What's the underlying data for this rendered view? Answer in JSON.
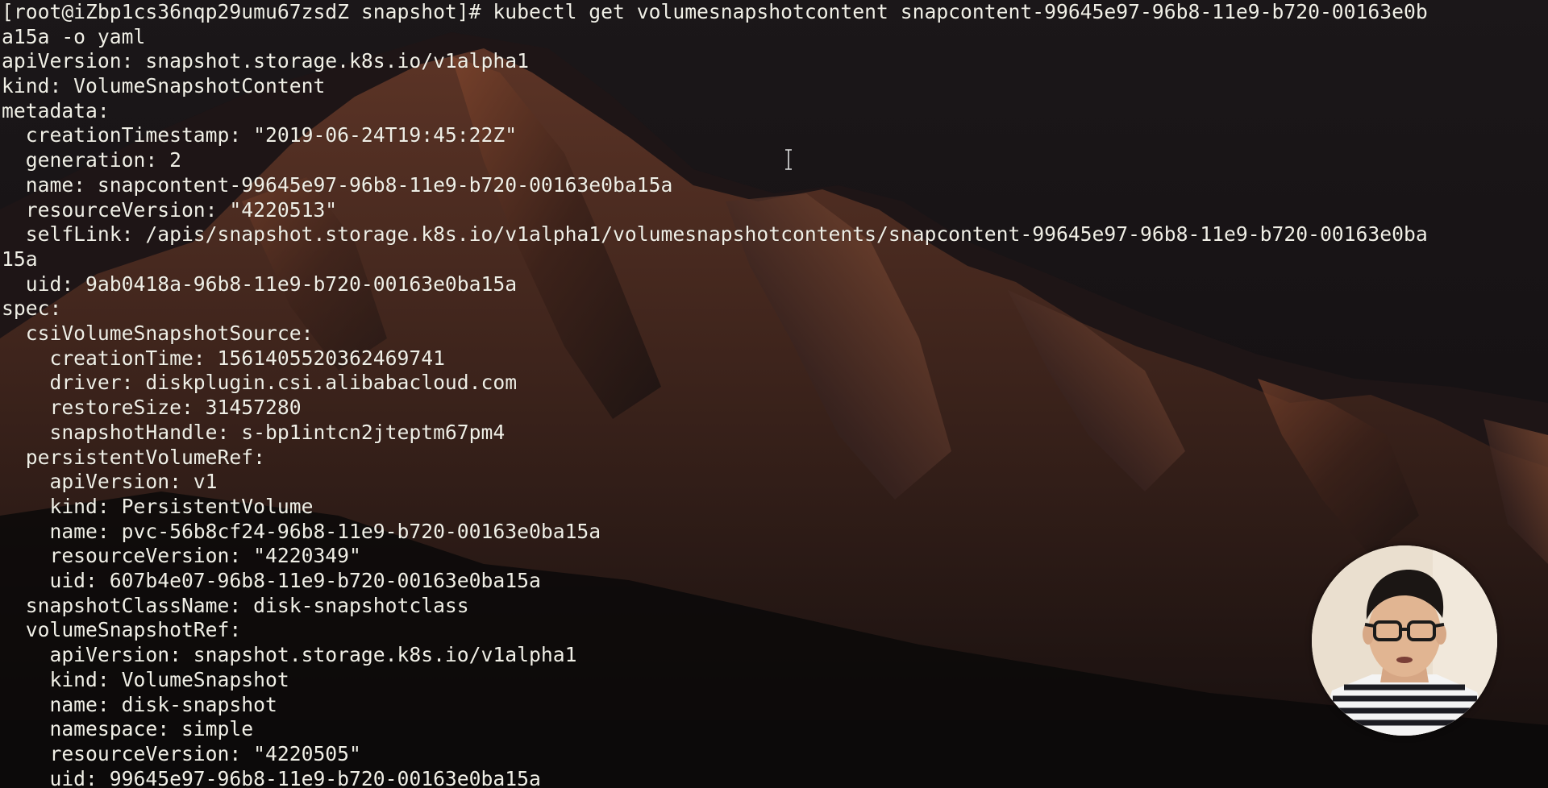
{
  "terminal": {
    "lines": [
      "[root@iZbp1cs36nqp29umu67zsdZ snapshot]# kubectl get volumesnapshotcontent snapcontent-99645e97-96b8-11e9-b720-00163e0b",
      "a15a -o yaml",
      "apiVersion: snapshot.storage.k8s.io/v1alpha1",
      "kind: VolumeSnapshotContent",
      "metadata:",
      "  creationTimestamp: \"2019-06-24T19:45:22Z\"",
      "  generation: 2",
      "  name: snapcontent-99645e97-96b8-11e9-b720-00163e0ba15a",
      "  resourceVersion: \"4220513\"",
      "  selfLink: /apis/snapshot.storage.k8s.io/v1alpha1/volumesnapshotcontents/snapcontent-99645e97-96b8-11e9-b720-00163e0ba",
      "15a",
      "  uid: 9ab0418a-96b8-11e9-b720-00163e0ba15a",
      "spec:",
      "  csiVolumeSnapshotSource:",
      "    creationTime: 1561405520362469741",
      "    driver: diskplugin.csi.alibabacloud.com",
      "    restoreSize: 31457280",
      "    snapshotHandle: s-bp1intcn2jteptm67pm4",
      "  persistentVolumeRef:",
      "    apiVersion: v1",
      "    kind: PersistentVolume",
      "    name: pvc-56b8cf24-96b8-11e9-b720-00163e0ba15a",
      "    resourceVersion: \"4220349\"",
      "    uid: 607b4e07-96b8-11e9-b720-00163e0ba15a",
      "  snapshotClassName: disk-snapshotclass",
      "  volumeSnapshotRef:",
      "    apiVersion: snapshot.storage.k8s.io/v1alpha1",
      "    kind: VolumeSnapshot",
      "    name: disk-snapshot",
      "    namespace: simple",
      "    resourceVersion: \"4220505\"",
      "    uid: 99645e97-96b8-11e9-b720-00163e0ba15a"
    ]
  },
  "colors": {
    "text": "#f0efe6",
    "background": "#0b0a0d",
    "mountain_highlight": "#8a4a30"
  },
  "icons": {
    "cursor": "text-cursor-ibeam-icon",
    "webcam": "presenter-webcam-avatar"
  }
}
